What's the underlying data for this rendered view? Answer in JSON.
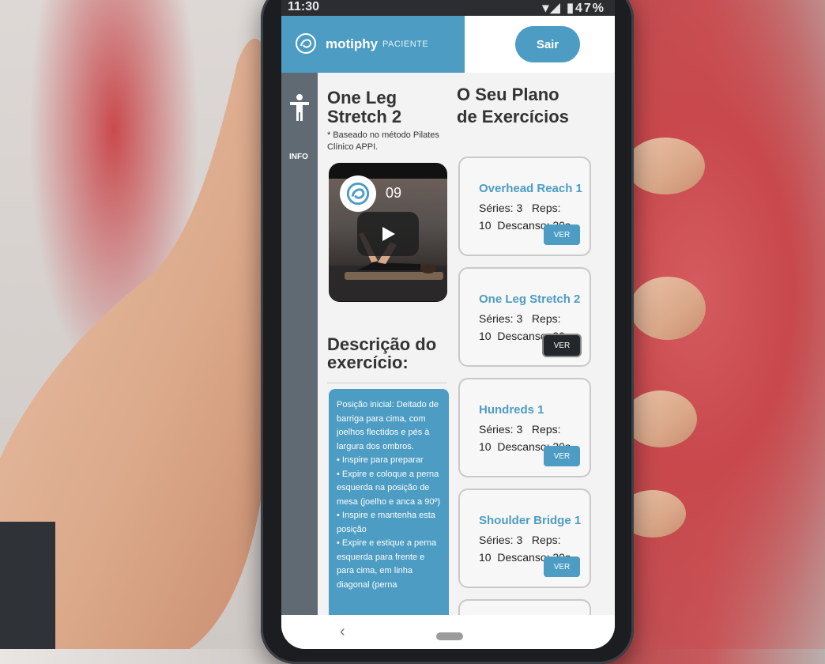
{
  "status": {
    "time": "11:30",
    "battery": "47%"
  },
  "header": {
    "brand": "motiphy",
    "role": "PACIENTE",
    "logout_label": "Sair"
  },
  "sidebar": {
    "info_label": "INFO"
  },
  "exercise": {
    "title": "One Leg Stretch 2",
    "note": "* Baseado no método Pilates Clínico APPI.",
    "video_number": "09"
  },
  "description": {
    "title": "Descrição do exercício:",
    "text": "Posição inicial: Deitado de barriga para cima, com joelhos flectidos e pés à largura dos ombros.\n• Inspire para preparar\n• Expire e coloque a perna esquerda na posição de mesa (joelho e anca a 90º)\n• Inspire e mantenha esta posição\n• Expire e estique a perna esquerda para frente e para cima, em linha diagonal (perna"
  },
  "plan": {
    "title": "O Seu Plano de Exercícios",
    "items": [
      {
        "name": "Overhead Reach 1",
        "series": "Séries: 3",
        "reps": "Reps: 10",
        "rest": "Descanso: 30s",
        "button": "VER"
      },
      {
        "name": "One Leg Stretch 2",
        "series": "Séries: 3",
        "reps": "Reps: 10",
        "rest": "Descanso: 30s",
        "button": "VER"
      },
      {
        "name": "Hundreds 1",
        "series": "Séries: 3",
        "reps": "Reps: 10",
        "rest": "Descanso: 30s",
        "button": "VER"
      },
      {
        "name": "Shoulder Bridge 1",
        "series": "Séries: 3",
        "reps": "Reps: 10",
        "rest": "Descanso: 30s",
        "button": "VER"
      }
    ]
  },
  "colors": {
    "accent": "#4c9cc3",
    "sidebar": "#5f6a73",
    "active_button": "#23272b"
  },
  "icons": [
    "logo-icon",
    "accessibility-icon",
    "play-icon",
    "back-icon"
  ]
}
